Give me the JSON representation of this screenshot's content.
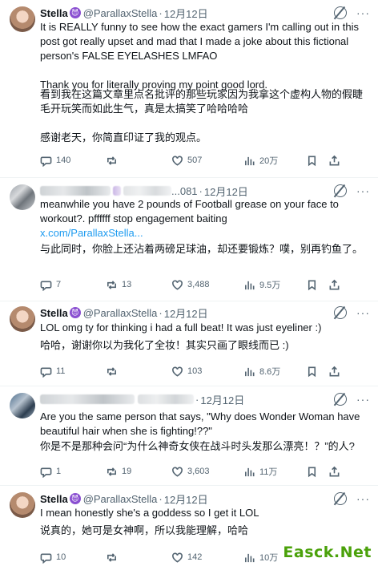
{
  "tweets": [
    {
      "author": "Stella",
      "badge": "😈",
      "handle": "@ParallaxStella",
      "date": "12月12日",
      "text": "It is REALLY funny to see how the exact gamers I'm calling out in this post got really upset and mad that I made a joke about this fictional person's FALSE EYELASHES LMFAO\n\nThank you for literally proving my point good lord.",
      "translation": "看到我在这篇文章里点名批评的那些玩家因为我拿这个虚构人物的假睫毛开玩笑而如此生气，真是太搞笑了哈哈哈哈\n\n感谢老天，你简直印证了我的观点。",
      "replies": "140",
      "reposts": "",
      "likes": "507",
      "views": "20万"
    },
    {
      "handle_suffix": "...081",
      "date": "12月12日",
      "text": "meanwhile you have 2 pounds of Football grease on your face to workout?. pffffff  stop engagement baiting",
      "link": "x.com/ParallaxStella...",
      "translation": "与此同时，你脸上还沾着两磅足球油，却还要锻炼？噗，别再钓鱼了。",
      "replies": "7",
      "reposts": "13",
      "likes": "3,488",
      "views": "9.5万"
    },
    {
      "author": "Stella",
      "badge": "😈",
      "handle": "@ParallaxStella",
      "date": "12月12日",
      "text": "LOL omg ty for thinking i had a full beat! It was just eyeliner :)",
      "translation": "哈哈，谢谢你以为我化了全妆！其实只画了眼线而已 :)",
      "replies": "11",
      "reposts": "",
      "likes": "103",
      "views": "8.6万"
    },
    {
      "date": "12月12日",
      "text": "Are you the same person that says, \"Why does Wonder Woman have beautiful hair when she is fighting!??\"",
      "translation": "你是不是那种会问“为什么神奇女侠在战斗时头发那么漂亮！？”的人?",
      "replies": "1",
      "reposts": "19",
      "likes": "3,603",
      "views": "11万"
    },
    {
      "author": "Stella",
      "badge": "😈",
      "handle": "@ParallaxStella",
      "date": "12月12日",
      "text": "I mean honestly she's a goddess so I get it LOL",
      "translation": "说真的，她可是女神啊，所以我能理解，哈哈",
      "replies": "10",
      "reposts": "",
      "likes": "142",
      "views": "10万"
    }
  ],
  "watermark": "Easck.Net",
  "colors": {
    "link": "#1d9bf0",
    "muted": "#536471",
    "badge": "#8a4fd1"
  }
}
